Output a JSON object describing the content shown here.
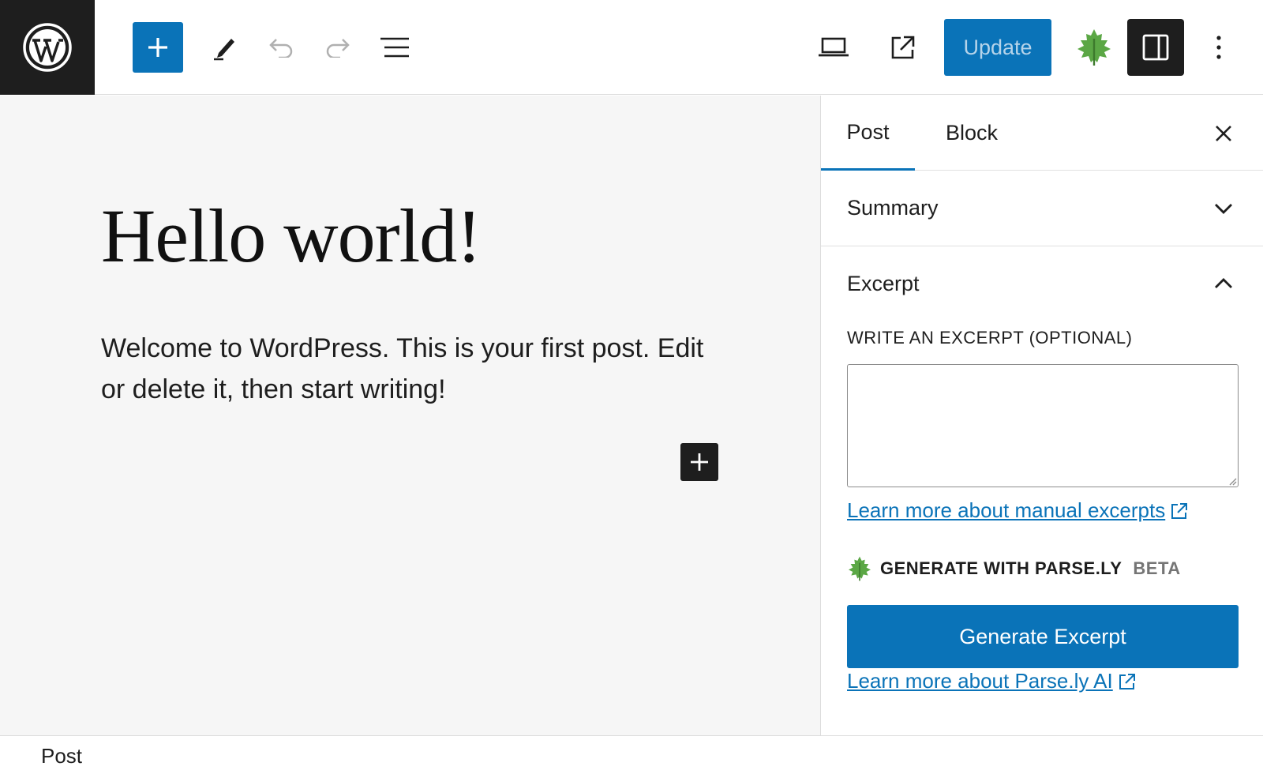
{
  "toolbar": {
    "update_label": "Update"
  },
  "editor": {
    "title": "Hello world!",
    "paragraph": "Welcome to WordPress. This is your first post. Edit or delete it, then start writing!"
  },
  "sidebar": {
    "tabs": [
      {
        "label": "Post"
      },
      {
        "label": "Block"
      }
    ],
    "summary_label": "Summary",
    "excerpt": {
      "title": "Excerpt",
      "field_label": "WRITE AN EXCERPT (OPTIONAL)",
      "value": "",
      "learn_more": "Learn more about manual excerpts",
      "generate_heading": "GENERATE WITH PARSE.LY",
      "beta_badge": "BETA",
      "generate_button": "Generate Excerpt",
      "parsely_link": "Learn more about Parse.ly AI"
    }
  },
  "footer": {
    "breadcrumb": "Post"
  },
  "colors": {
    "accent": "#0a73b8",
    "dark": "#1e1e1e",
    "parsely_green": "#5ba745"
  },
  "icons": [
    "wordpress-logo-icon",
    "plus-icon",
    "pen-tool-icon",
    "undo-icon",
    "redo-icon",
    "list-view-icon",
    "desktop-preview-icon",
    "external-link-icon",
    "parsely-leaf-icon",
    "sidebar-toggle-icon",
    "more-vertical-icon",
    "close-icon",
    "chevron-down-icon",
    "chevron-up-icon"
  ]
}
